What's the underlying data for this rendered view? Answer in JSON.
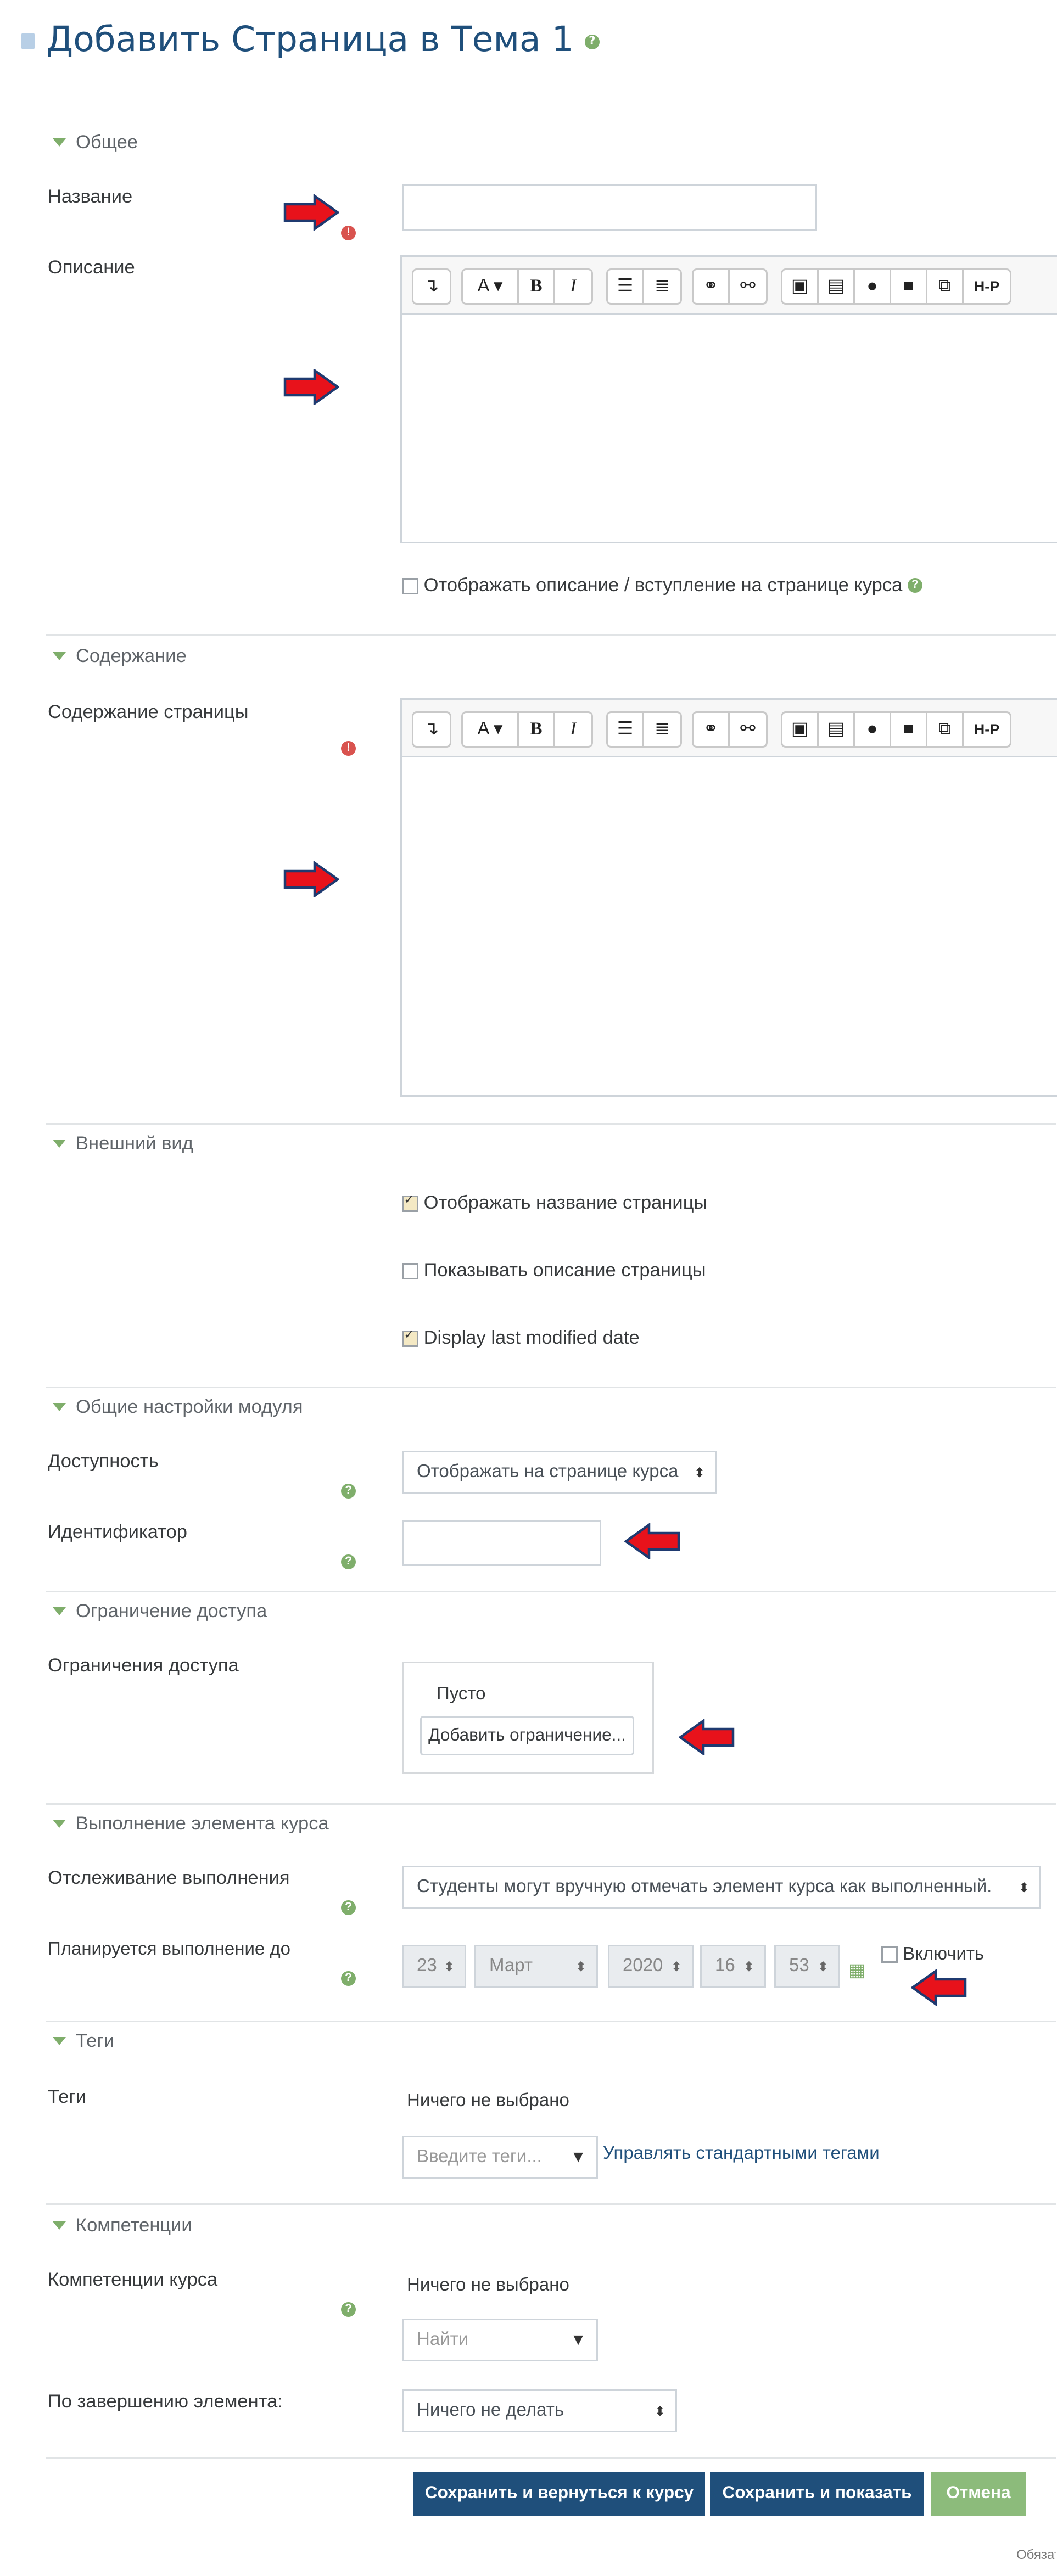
{
  "page": {
    "title": "Добавить Страница в Тема 1",
    "footer_note": "Обязат"
  },
  "sections": {
    "general": "Общее",
    "content": "Содержание",
    "appearance": "Внешний вид",
    "module": "Общие настройки модуля",
    "restrict": "Ограничение доступа",
    "completion": "Выполнение элемента курса",
    "tags": "Теги",
    "competencies": "Компетенции"
  },
  "fields": {
    "name_label": "Название",
    "name_value": "",
    "description_label": "Описание",
    "show_description": "Отображать описание / вступление на странице курса",
    "page_content_label": "Содержание страницы",
    "display_page_name": "Отображать название страницы",
    "display_page_description": "Показывать описание страницы",
    "display_last_modified": "Display last modified date",
    "availability_label": "Доступность",
    "availability_value": "Отображать на странице курса",
    "idnumber_label": "Идентификатор",
    "idnumber_value": "",
    "restrictions_label": "Ограничения доступа",
    "restrictions_empty": "Пусто",
    "add_restriction": "Добавить ограничение...",
    "tracking_label": "Отслеживание выполнения",
    "tracking_value": "Студенты могут вручную отмечать элемент курса как выполненный.",
    "expected_label": "Планируется выполнение до",
    "date_day": "23",
    "date_month": "Март",
    "date_year": "2020",
    "date_hour": "16",
    "date_minute": "53",
    "enable": "Включить",
    "tags_label": "Теги",
    "tags_none": "Ничего не выбрано",
    "tags_placeholder": "Введите теги...",
    "manage_tags": "Управлять стандартными тегами",
    "course_comp_label": "Компетенции курса",
    "comp_none": "Ничего не выбрано",
    "comp_search": "Найти",
    "on_completion_label": "По завершению элемента:",
    "on_completion_value": "Ничего не делать"
  },
  "checkboxes": {
    "show_description": false,
    "display_page_name": true,
    "display_page_description": false,
    "display_last_modified": true,
    "enable_date": false
  },
  "buttons": {
    "save_return": "Сохранить и вернуться к курсу",
    "save_display": "Сохранить и показать",
    "cancel": "Отмена"
  },
  "editor_toolbar": {
    "icons": [
      "expand-icon",
      "font-color-icon",
      "bold-icon",
      "italic-icon",
      "unordered-list-icon",
      "ordered-list-icon",
      "link-icon",
      "unlink-icon",
      "image-icon",
      "media-icon",
      "record-audio-icon",
      "record-video-icon",
      "manage-files-icon",
      "h5p-icon"
    ],
    "bold": "B",
    "italic": "I",
    "font": "A",
    "h5p": "H-P"
  },
  "colors": {
    "accent": "#1f4f7b",
    "help": "#7fae6b",
    "required": "#d9534f",
    "arrow": "#e8121b",
    "cancel": "#8cbb7b"
  }
}
